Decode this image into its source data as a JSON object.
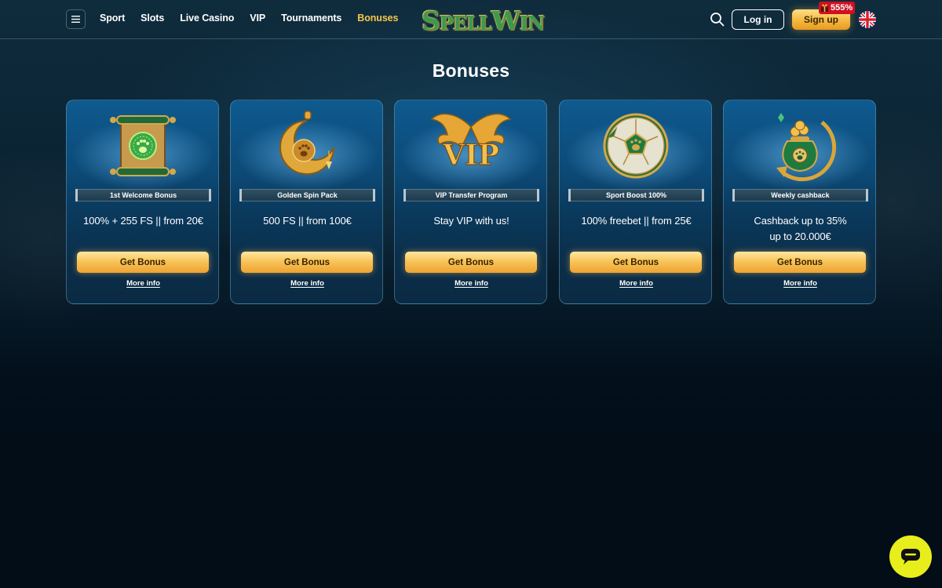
{
  "header": {
    "nav": [
      {
        "label": "Sport",
        "active": false
      },
      {
        "label": "Slots",
        "active": false
      },
      {
        "label": "Live Casino",
        "active": false
      },
      {
        "label": "VIP",
        "active": false
      },
      {
        "label": "Tournaments",
        "active": false
      },
      {
        "label": "Bonuses",
        "active": true
      }
    ],
    "logo_text_a": "S",
    "logo_text_b": "PELL",
    "logo_text_c": "W",
    "logo_text_d": "IN",
    "login_label": "Log in",
    "signup_label": "Sign up",
    "promo_badge": "555%",
    "language_flag": "uk-flag-icon"
  },
  "page": {
    "title": "Bonuses"
  },
  "bonuses": [
    {
      "name": "1st Welcome Bonus",
      "offer_line1": "100% + 255 FS || from 20€",
      "offer_line2": "",
      "button": "Get Bonus",
      "link": "More info",
      "icon": "scroll-icon"
    },
    {
      "name": "Golden Spin Pack",
      "offer_line1": "500 FS || from 100€",
      "offer_line2": "",
      "button": "Get Bonus",
      "link": "More info",
      "icon": "moon-pendant-icon"
    },
    {
      "name": "VIP Transfer Program",
      "offer_line1": "Stay VIP with us!",
      "offer_line2": "",
      "button": "Get Bonus",
      "link": "More info",
      "icon": "vip-wings-icon"
    },
    {
      "name": "Sport Boost 100%",
      "offer_line1": "100% freebet || from 25€",
      "offer_line2": "",
      "button": "Get Bonus",
      "link": "More info",
      "icon": "football-icon"
    },
    {
      "name": "Weekly cashback",
      "offer_line1": "Cashback up to 35%",
      "offer_line2": "up to 20.000€",
      "button": "Get Bonus",
      "link": "More info",
      "icon": "coin-bag-icon"
    }
  ],
  "colors": {
    "accent_gold": "#f6c64a",
    "background": "#020d18",
    "card_blue": "#0c4a77",
    "chat_yellow": "#e7ee1c",
    "badge_red": "#d01020"
  }
}
